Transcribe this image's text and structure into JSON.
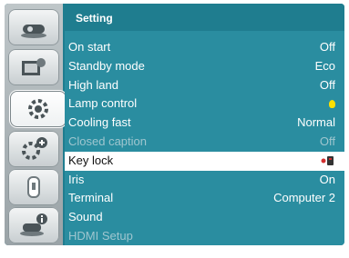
{
  "menu_title": "Setting",
  "sidebar": [
    {
      "name": "display-icon"
    },
    {
      "name": "image-adjust-icon"
    },
    {
      "name": "setting-gear-icon"
    },
    {
      "name": "expanded-gear-plus-icon"
    },
    {
      "name": "usb-memory-icon"
    },
    {
      "name": "info-icon"
    }
  ],
  "rows": [
    {
      "label": "On start",
      "value": "Off"
    },
    {
      "label": "Standby mode",
      "value": "Eco"
    },
    {
      "label": "High land",
      "value": "Off"
    },
    {
      "label": "Lamp control",
      "value": "",
      "icon": "lamp-bulb-icon"
    },
    {
      "label": "Cooling fast",
      "value": "Normal"
    },
    {
      "label": "Closed caption",
      "value": "Off",
      "disabled": true
    },
    {
      "label": "Key lock",
      "value": "",
      "icon": "key-lock-remote-icon",
      "selected": true
    },
    {
      "label": "Iris",
      "value": "On"
    },
    {
      "label": "Terminal",
      "value": "Computer 2"
    },
    {
      "label": "Sound",
      "value": ""
    },
    {
      "label": "HDMI Setup",
      "value": "",
      "disabled": true
    }
  ],
  "colors": {
    "panel": "#2a8da0",
    "title_bar": "#1f7d8f",
    "highlight": "#ffffff",
    "bulb": "#ffe000"
  }
}
